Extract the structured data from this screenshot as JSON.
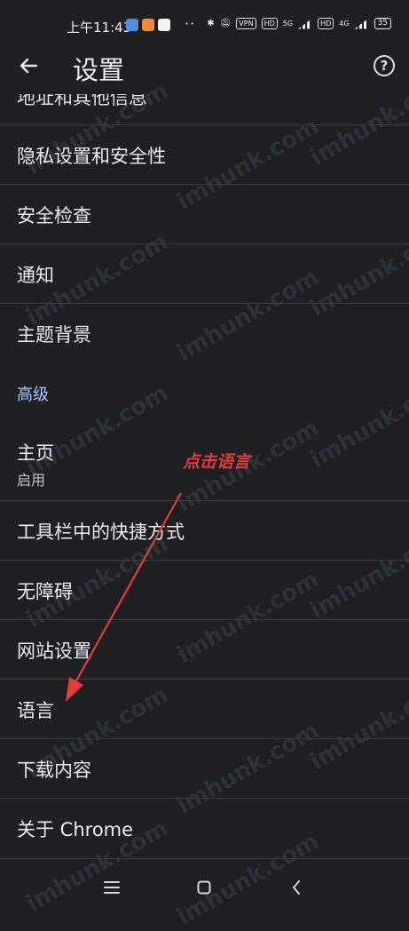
{
  "status_bar": {
    "time": "上午11:43",
    "dots": "··",
    "vpn": "VPN",
    "hd1": "HD",
    "net1": "5G",
    "hd2": "HD",
    "net2": "4G",
    "battery": "35"
  },
  "app_bar": {
    "title": "设置",
    "back_icon": "arrow-left",
    "help_icon": "question-circle"
  },
  "list": {
    "cut_item": "地址和其他信息",
    "items": [
      {
        "label": "隐私设置和安全性"
      },
      {
        "label": "安全检查"
      },
      {
        "label": "通知"
      },
      {
        "label": "主题背景"
      }
    ],
    "section_header": "高级",
    "homepage": {
      "label": "主页",
      "sub": "启用"
    },
    "items2": [
      {
        "label": "工具栏中的快捷方式"
      },
      {
        "label": "无障碍"
      },
      {
        "label": "网站设置"
      },
      {
        "label": "语言"
      },
      {
        "label": "下载内容"
      },
      {
        "label": "关于 Chrome"
      }
    ]
  },
  "annotation": {
    "text": "点击语言",
    "color": "#e63a3a"
  },
  "watermark": "imhunk.com",
  "colors": {
    "background": "#1f1f22",
    "accent": "#a8c7fa",
    "divider": "#3a3a3e"
  }
}
